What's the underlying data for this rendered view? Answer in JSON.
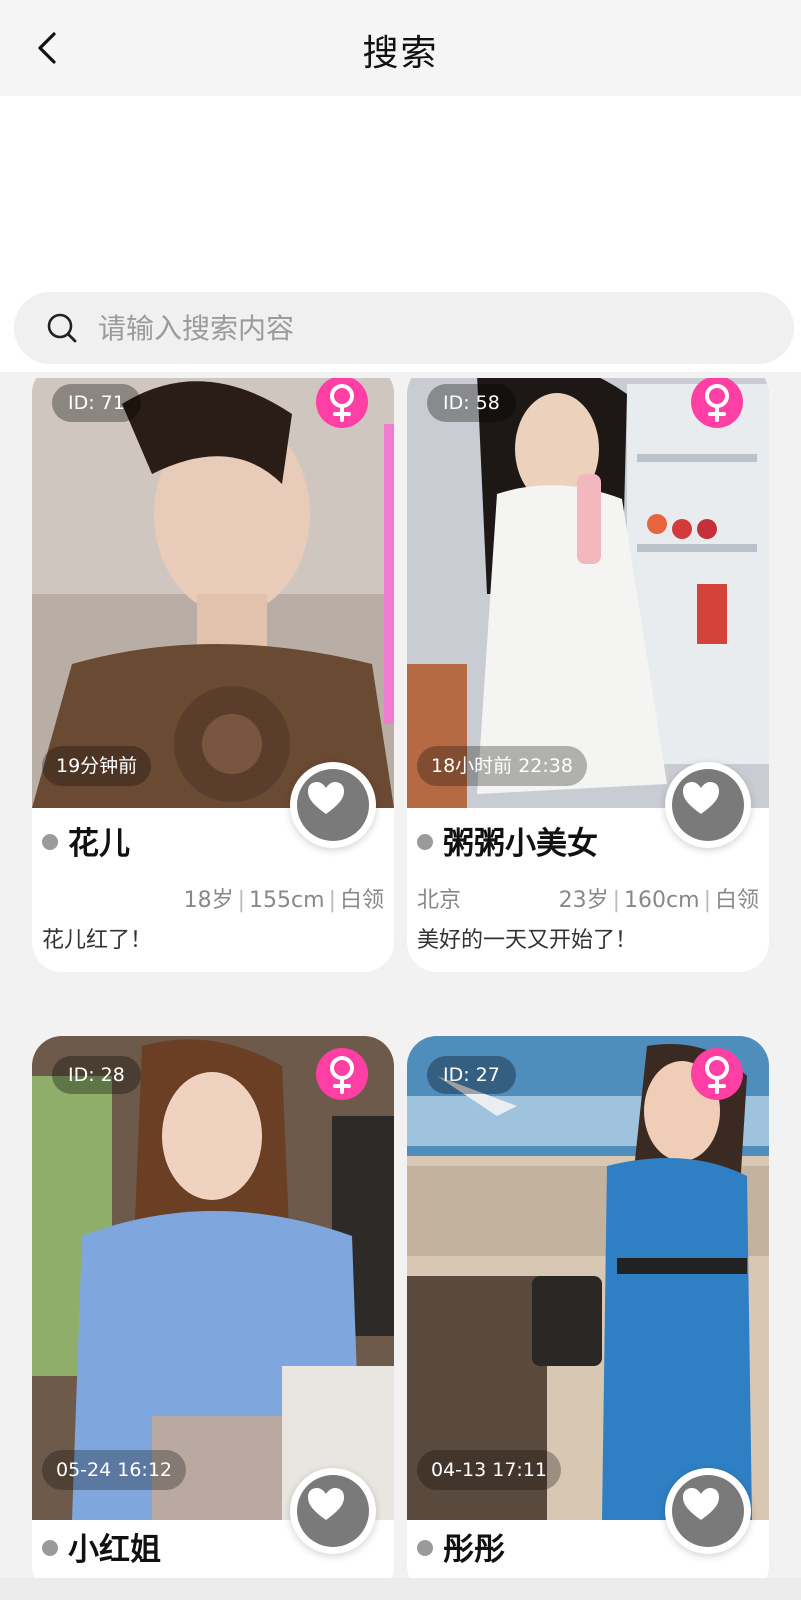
{
  "header": {
    "title": "搜索",
    "back_icon": "chevron-left-icon"
  },
  "search": {
    "placeholder": "请输入搜索内容",
    "value": "",
    "icon": "search-icon"
  },
  "profiles": [
    {
      "id_label": "ID: 71",
      "time": "19分钟前",
      "name": "花儿",
      "city": "",
      "age": "18岁",
      "height": "155cm",
      "job": "白领",
      "bio": "花儿红了！",
      "photo_palette": [
        "#b8aca4",
        "#6b4a34",
        "#e6c9b8"
      ]
    },
    {
      "id_label": "ID: 58",
      "time": "18小时前 22:38",
      "name": "粥粥小美女",
      "city": "北京",
      "age": "23岁",
      "height": "160cm",
      "job": "白领",
      "bio": "美好的一天又开始了！",
      "photo_palette": [
        "#c9ccd2",
        "#f2f2f0",
        "#9aa3ae"
      ]
    },
    {
      "id_label": "ID: 28",
      "time": "05-24 16:12",
      "name": "小红姐",
      "photo_palette": [
        "#6e5a4a",
        "#7fa7de",
        "#d9c9c0"
      ]
    },
    {
      "id_label": "ID: 27",
      "time": "04-13 17:11",
      "name": "彤彤",
      "photo_palette": [
        "#6fa6cf",
        "#2f7fc4",
        "#c9b7a4"
      ]
    }
  ],
  "colors": {
    "accent_pink": "#ff3fa4",
    "like_gray": "#7a7a7a",
    "online_dot": "#9a9a9a"
  }
}
